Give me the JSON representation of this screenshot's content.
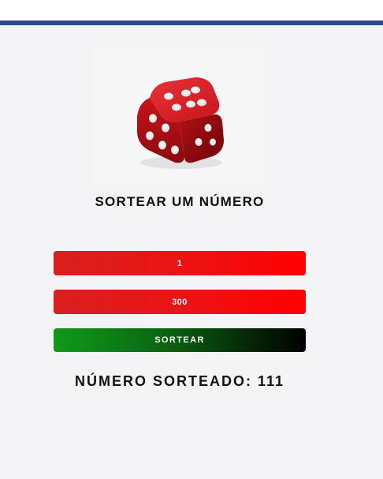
{
  "colors": {
    "top_bar": "#2c4a86",
    "background": "#f4f3f5",
    "field_red": "#ee1212",
    "button_green": "#0f9a1a",
    "button_black": "#000000",
    "text": "#111111",
    "dice_red": "#c8141a"
  },
  "header": {
    "icon": "dice-icon"
  },
  "title": "SORTEAR UM NÚMERO",
  "form": {
    "min_value": "1",
    "max_value": "300",
    "draw_button_label": "SORTEAR"
  },
  "result": {
    "label": "NÚMERO SORTEADO:",
    "value": "111"
  }
}
